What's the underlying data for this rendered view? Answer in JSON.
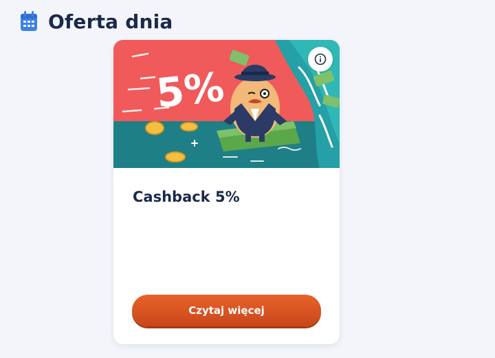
{
  "section": {
    "title": "Oferta dnia",
    "icon": "calendar-icon"
  },
  "offer": {
    "image_badge": "5%",
    "info_icon": "info-icon",
    "title": "Cashback 5%",
    "cta_label": "Czytaj więcej"
  },
  "colors": {
    "title_text": "#1b2a4a",
    "calendar_icon": "#3b82e6",
    "cta_top": "#e8632a",
    "cta_bottom": "#c9461b",
    "banner_red": "#f05a5a",
    "banner_teal": "#1f7f86"
  }
}
